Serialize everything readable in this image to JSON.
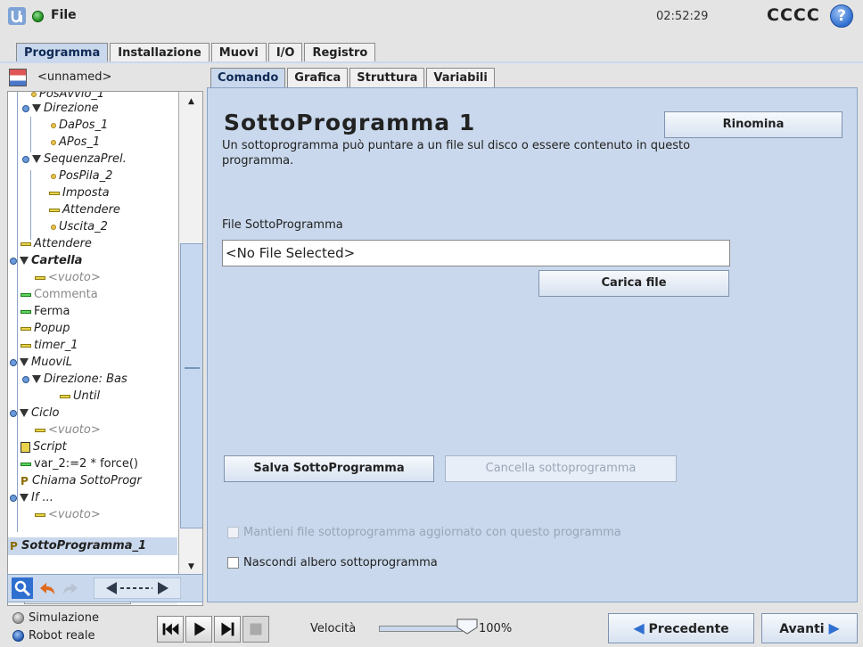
{
  "topbar": {
    "menu_label": "File",
    "clock": "02:52:29",
    "robot_name": "CCCC",
    "help_label": "?"
  },
  "main_tabs": [
    "Programma",
    "Installazione",
    "Muovi",
    "I/O",
    "Registro"
  ],
  "program": {
    "name": "<unnamed>"
  },
  "tree": [
    {
      "label": "PosAvvio_1",
      "style": "italic"
    },
    {
      "label": "Direzione",
      "style": "italic"
    },
    {
      "label": "DaPos_1",
      "style": "italic"
    },
    {
      "label": "APos_1",
      "style": "italic"
    },
    {
      "label": "SequenzaPrel.",
      "style": "italic"
    },
    {
      "label": "PosPila_2",
      "style": "italic"
    },
    {
      "label": "Imposta",
      "style": "italic"
    },
    {
      "label": "Attendere",
      "style": "italic"
    },
    {
      "label": "Uscita_2",
      "style": "italic"
    },
    {
      "label": "Attendere",
      "style": "italic"
    },
    {
      "label": "Cartella",
      "style": "bold-italic"
    },
    {
      "label": "<vuoto>",
      "style": "grey-italic"
    },
    {
      "label": "Commenta",
      "style": "grey"
    },
    {
      "label": "Ferma",
      "style": "normal"
    },
    {
      "label": "Popup",
      "style": "italic"
    },
    {
      "label": "timer_1",
      "style": "italic"
    },
    {
      "label": "MuoviL",
      "style": "italic"
    },
    {
      "label": "Direzione: Bas",
      "style": "italic"
    },
    {
      "label": "Until",
      "style": "italic"
    },
    {
      "label": "Ciclo",
      "style": "italic"
    },
    {
      "label": "<vuoto>",
      "style": "grey-italic"
    },
    {
      "label": "Script",
      "style": "italic"
    },
    {
      "label": "var_2:=2 * force()",
      "style": "normal"
    },
    {
      "label": "Chiama SottoProgr",
      "style": "italic"
    },
    {
      "label": "If ...",
      "style": "italic"
    },
    {
      "label": "<vuoto>",
      "style": "grey-italic"
    },
    {
      "label": "SottoProgramma_1",
      "style": "bold-italic"
    }
  ],
  "sub_tabs": [
    "Comando",
    "Grafica",
    "Struttura",
    "Variabili"
  ],
  "content": {
    "title": "SottoProgramma 1",
    "rename_button": "Rinomina",
    "description": "Un sottoprogramma può puntare a un file sul disco o essere contenuto in questo programma.",
    "file_label": "File SottoProgramma",
    "file_value": "<No File Selected>",
    "load_button": "Carica file",
    "save_button": "Salva SottoProgramma",
    "clear_button": "Cancella sottoprogramma",
    "keep_updated_label": "Mantieni file sottoprogramma aggiornato con questo programma",
    "hide_tree_label": "Nascondi albero sottoprogramma"
  },
  "bottombar": {
    "simulation_label": "Simulazione",
    "real_robot_label": "Robot reale",
    "speed_label": "Velocità",
    "speed_value": "100%",
    "speed_fraction": 1.0,
    "prev_button": "Precedente",
    "next_button": "Avanti"
  },
  "colors": {
    "accent": "#c9d8ec",
    "button_blue": "#2f6fd0",
    "running_green": "#1a8a1a"
  }
}
